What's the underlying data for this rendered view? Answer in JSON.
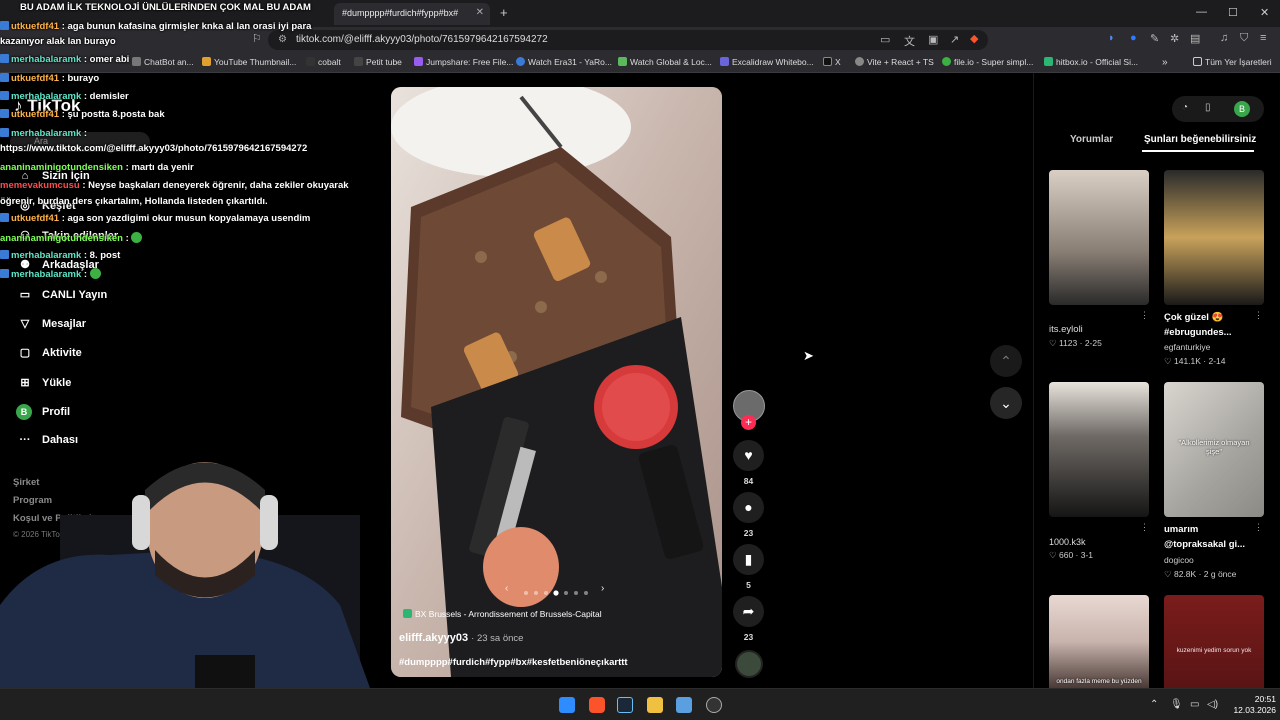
{
  "browser": {
    "tabs": [
      {
        "label": "BU ADAM İLK TEKNOLOJİ ÜNLÜLERİNDEN ÇOK MAL BU ADAM",
        "active": false
      },
      {
        "label": "#dumpppp#furdich#fypp#bx#",
        "active": true
      }
    ],
    "url": "tiktok.com/@elifff.akyyy03/photo/7615979642167594272",
    "bookmarks": [
      "ChatBot an...",
      "YouTube Thumbnail...",
      "cobalt",
      "Petit tube",
      "Jumpshare: Free File...",
      "Watch Era31 - YaRo...",
      "Watch Global & Loc...",
      "Excalidraw Whitebo...",
      "X",
      "Vite + React + TS",
      "file.io - Super simpl...",
      "hitbox.io - Official Si..."
    ],
    "bookmarks_folder": "Tüm Yer İşaretleri"
  },
  "tiktok": {
    "logo": "TikTok",
    "search_placeholder": "Ara",
    "nav": [
      {
        "label": "Sizin İçin",
        "icon": "home-icon"
      },
      {
        "label": "Keşfet",
        "icon": "compass-icon"
      },
      {
        "label": "Takip edilenler",
        "icon": "following-icon"
      },
      {
        "label": "Arkadaşlar",
        "icon": "friends-icon"
      },
      {
        "label": "CANLI Yayın",
        "icon": "live-icon"
      },
      {
        "label": "Mesajlar",
        "icon": "message-icon"
      },
      {
        "label": "Aktivite",
        "icon": "activity-icon"
      },
      {
        "label": "Yükle",
        "icon": "upload-icon"
      },
      {
        "label": "Profil",
        "icon": "profile-icon",
        "avatar_letter": "B"
      },
      {
        "label": "Dahası",
        "icon": "more-icon"
      }
    ],
    "footer": [
      "Şirket",
      "Program",
      "Koşul ve Politikalar"
    ],
    "copyright": "© 2026 TikTok"
  },
  "chat": [
    {
      "user": "",
      "text": "BU ADAM İLK TEKNOLOJİ ÜNLÜLERİNDEN ÇOK MAL BU ADAM",
      "color": "orange"
    },
    {
      "user": "utkuefdf41",
      "text": ": aga bunun kafasina girmişler knka al lan orasi iyi para",
      "color": "orange"
    },
    {
      "user": "",
      "text": "kazanıyor alak lan burayo",
      "color": ""
    },
    {
      "user": "merhabalaramk",
      "text": ": omer abi",
      "color": "teal"
    },
    {
      "user": "utkuefdf41",
      "text": ": burayo",
      "color": "orange"
    },
    {
      "user": "merhabalaramk",
      "text": ": demisler",
      "color": "teal"
    },
    {
      "user": "utkuefdf41",
      "text": ": şu postta 8.posta bak",
      "color": "orange"
    },
    {
      "user": "merhabalaramk",
      "text": ":",
      "color": "teal"
    },
    {
      "user": "",
      "text": "https://www.tiktok.com/@elifff.akyyy03/photo/7615979642167594272",
      "color": ""
    },
    {
      "user": "ananinaminigotundensiken",
      "text": ": martı da yenir",
      "color": "green"
    },
    {
      "user": "memevakumcusu",
      "text": ": Neyse başkaları deneyerek öğrenir, daha zekiler okuyarak",
      "color": "red"
    },
    {
      "user": "",
      "text": "öğrenir, burdan ders çıkartalım, Hollanda listeden çıkartıldı.",
      "color": ""
    },
    {
      "user": "utkuefdf41",
      "text": ": aga son yazdigimi okur musun kopyalamaya usendim",
      "color": "orange"
    },
    {
      "user": "ananinaminigotundensiken",
      "text": ":",
      "color": "green"
    },
    {
      "user": "merhabalaramk",
      "text": ": 8. post",
      "color": "teal"
    },
    {
      "user": "merhabalaramk",
      "text": ":",
      "color": "teal"
    }
  ],
  "post": {
    "location": "BX Brussels - Arrondissement of Brussels-Capital",
    "author": "elifff.akyyy03",
    "time": "· 23 sa önce",
    "caption": "#dumpppp#furdich#fypp#bx#kesfetbeniöneçıkarttt",
    "carousel_total": 7,
    "carousel_active": 4,
    "likes": "84",
    "comments": "23",
    "saves": "5",
    "shares": "23"
  },
  "panel": {
    "tabs": [
      "Yorumlar",
      "Şunları beğenebilirsiniz"
    ],
    "profile_letter": "B",
    "items": [
      {
        "title": "its.eyloli",
        "author": "",
        "likes": "1123",
        "date": "2-25",
        "colors": [
          "#d9cfc4",
          "#2a2a2a"
        ]
      },
      {
        "title": "Çok güzel 😍",
        "title2": "#ebrugundes...",
        "author": "egfanturkiye",
        "likes": "141.1K",
        "date": "2-14",
        "colors": [
          "#c9a25b",
          "#1a1a1a"
        ]
      },
      {
        "title": "1000.k3k",
        "author": "",
        "likes": "660",
        "date": "3-1",
        "colors": [
          "#e8e4dc",
          "#151515"
        ]
      },
      {
        "title": "umarım",
        "title2": "@topraksakal gi...",
        "author": "dogicoo",
        "likes": "82.8K",
        "date": "2 g önce",
        "overlay": "\"Alkollerimiz olmayan şişe\"",
        "colors": [
          "#a6a49f",
          "#d9d6d0"
        ]
      },
      {
        "title": "",
        "author": "",
        "likes": "",
        "date": "",
        "overlay": "ondan fazla meme bu yüzden",
        "colors": [
          "#c8b4ad",
          "#4a3a36"
        ]
      },
      {
        "title": "",
        "author": "",
        "likes": "",
        "date": "",
        "overlay": "kuzenimi yedim sorun yok",
        "colors": [
          "#7a1c1c",
          "#f2e6e6"
        ]
      }
    ]
  },
  "taskbar": {
    "time": "20:51",
    "date": "12.03.2026"
  }
}
